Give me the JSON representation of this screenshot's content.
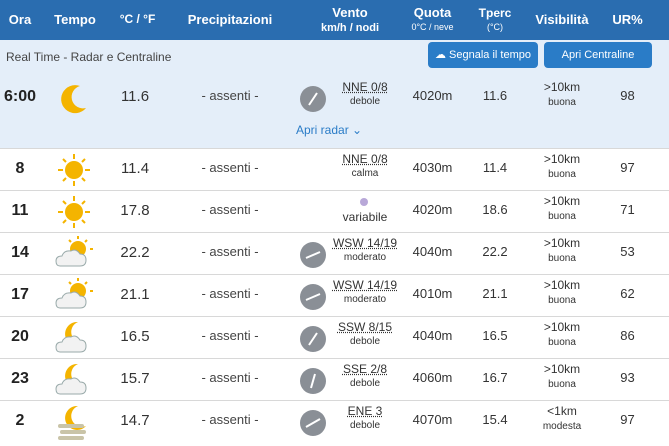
{
  "header": {
    "ora": "Ora",
    "tempo": "Tempo",
    "temp_unit": "°C / °F",
    "precipitazioni": "Precipitazioni",
    "vento": "Vento",
    "vento_unit": "km/h / nodi",
    "quota": "Quota",
    "quota_unit": "0°C / neve",
    "tperc": "Tperc",
    "tperc_unit": "(°C)",
    "visibilita": "Visibilità",
    "ur": "UR%"
  },
  "realtime": {
    "title": "Real Time - Radar e Centraline",
    "segnala_label": "Segnala il tempo",
    "centraline_label": "Apri Centraline",
    "radar_link": "Apri radar"
  },
  "rows": [
    {
      "ora": "6:00",
      "icon": "moon-icon",
      "temp": "11.6",
      "prec": "- assenti -",
      "wind_dir": "NNE 0/8",
      "wind_str": "debole",
      "quota": "4020m",
      "tperc": "11.6",
      "vis1": ">10km",
      "vis2": "buona",
      "ur": "98"
    },
    {
      "ora": "8",
      "icon": "sun-icon",
      "temp": "11.4",
      "prec": "- assenti -",
      "wind_dir": "NNE 0/8",
      "wind_str": "calma",
      "quota": "4030m",
      "tperc": "11.4",
      "vis1": ">10km",
      "vis2": "buona",
      "ur": "97"
    },
    {
      "ora": "11",
      "icon": "sun-icon",
      "temp": "17.8",
      "prec": "- assenti -",
      "wind_dir": "",
      "wind_str": "variabile",
      "quota": "4020m",
      "tperc": "18.6",
      "vis1": ">10km",
      "vis2": "buona",
      "ur": "71"
    },
    {
      "ora": "14",
      "icon": "sun-cloud-icon",
      "temp": "22.2",
      "prec": "- assenti -",
      "wind_dir": "WSW 14/19",
      "wind_str": "moderato",
      "quota": "4040m",
      "tperc": "22.2",
      "vis1": ">10km",
      "vis2": "buona",
      "ur": "53"
    },
    {
      "ora": "17",
      "icon": "sun-cloud-icon",
      "temp": "21.1",
      "prec": "- assenti -",
      "wind_dir": "WSW 14/19",
      "wind_str": "moderato",
      "quota": "4010m",
      "tperc": "21.1",
      "vis1": ">10km",
      "vis2": "buona",
      "ur": "62"
    },
    {
      "ora": "20",
      "icon": "moon-cloud-icon",
      "temp": "16.5",
      "prec": "- assenti -",
      "wind_dir": "SSW 8/15",
      "wind_str": "debole",
      "quota": "4040m",
      "tperc": "16.5",
      "vis1": ">10km",
      "vis2": "buona",
      "ur": "86"
    },
    {
      "ora": "23",
      "icon": "moon-cloud-icon",
      "temp": "15.7",
      "prec": "- assenti -",
      "wind_dir": "SSE 2/8",
      "wind_str": "debole",
      "quota": "4060m",
      "tperc": "16.7",
      "vis1": ">10km",
      "vis2": "buona",
      "ur": "93"
    },
    {
      "ora": "2",
      "icon": "moon-fog-icon",
      "temp": "14.7",
      "prec": "- assenti -",
      "wind_dir": "ENE 3",
      "wind_str": "debole",
      "quota": "4070m",
      "tperc": "15.4",
      "vis1": "<1km",
      "vis2": "modesta",
      "ur": "97"
    }
  ]
}
